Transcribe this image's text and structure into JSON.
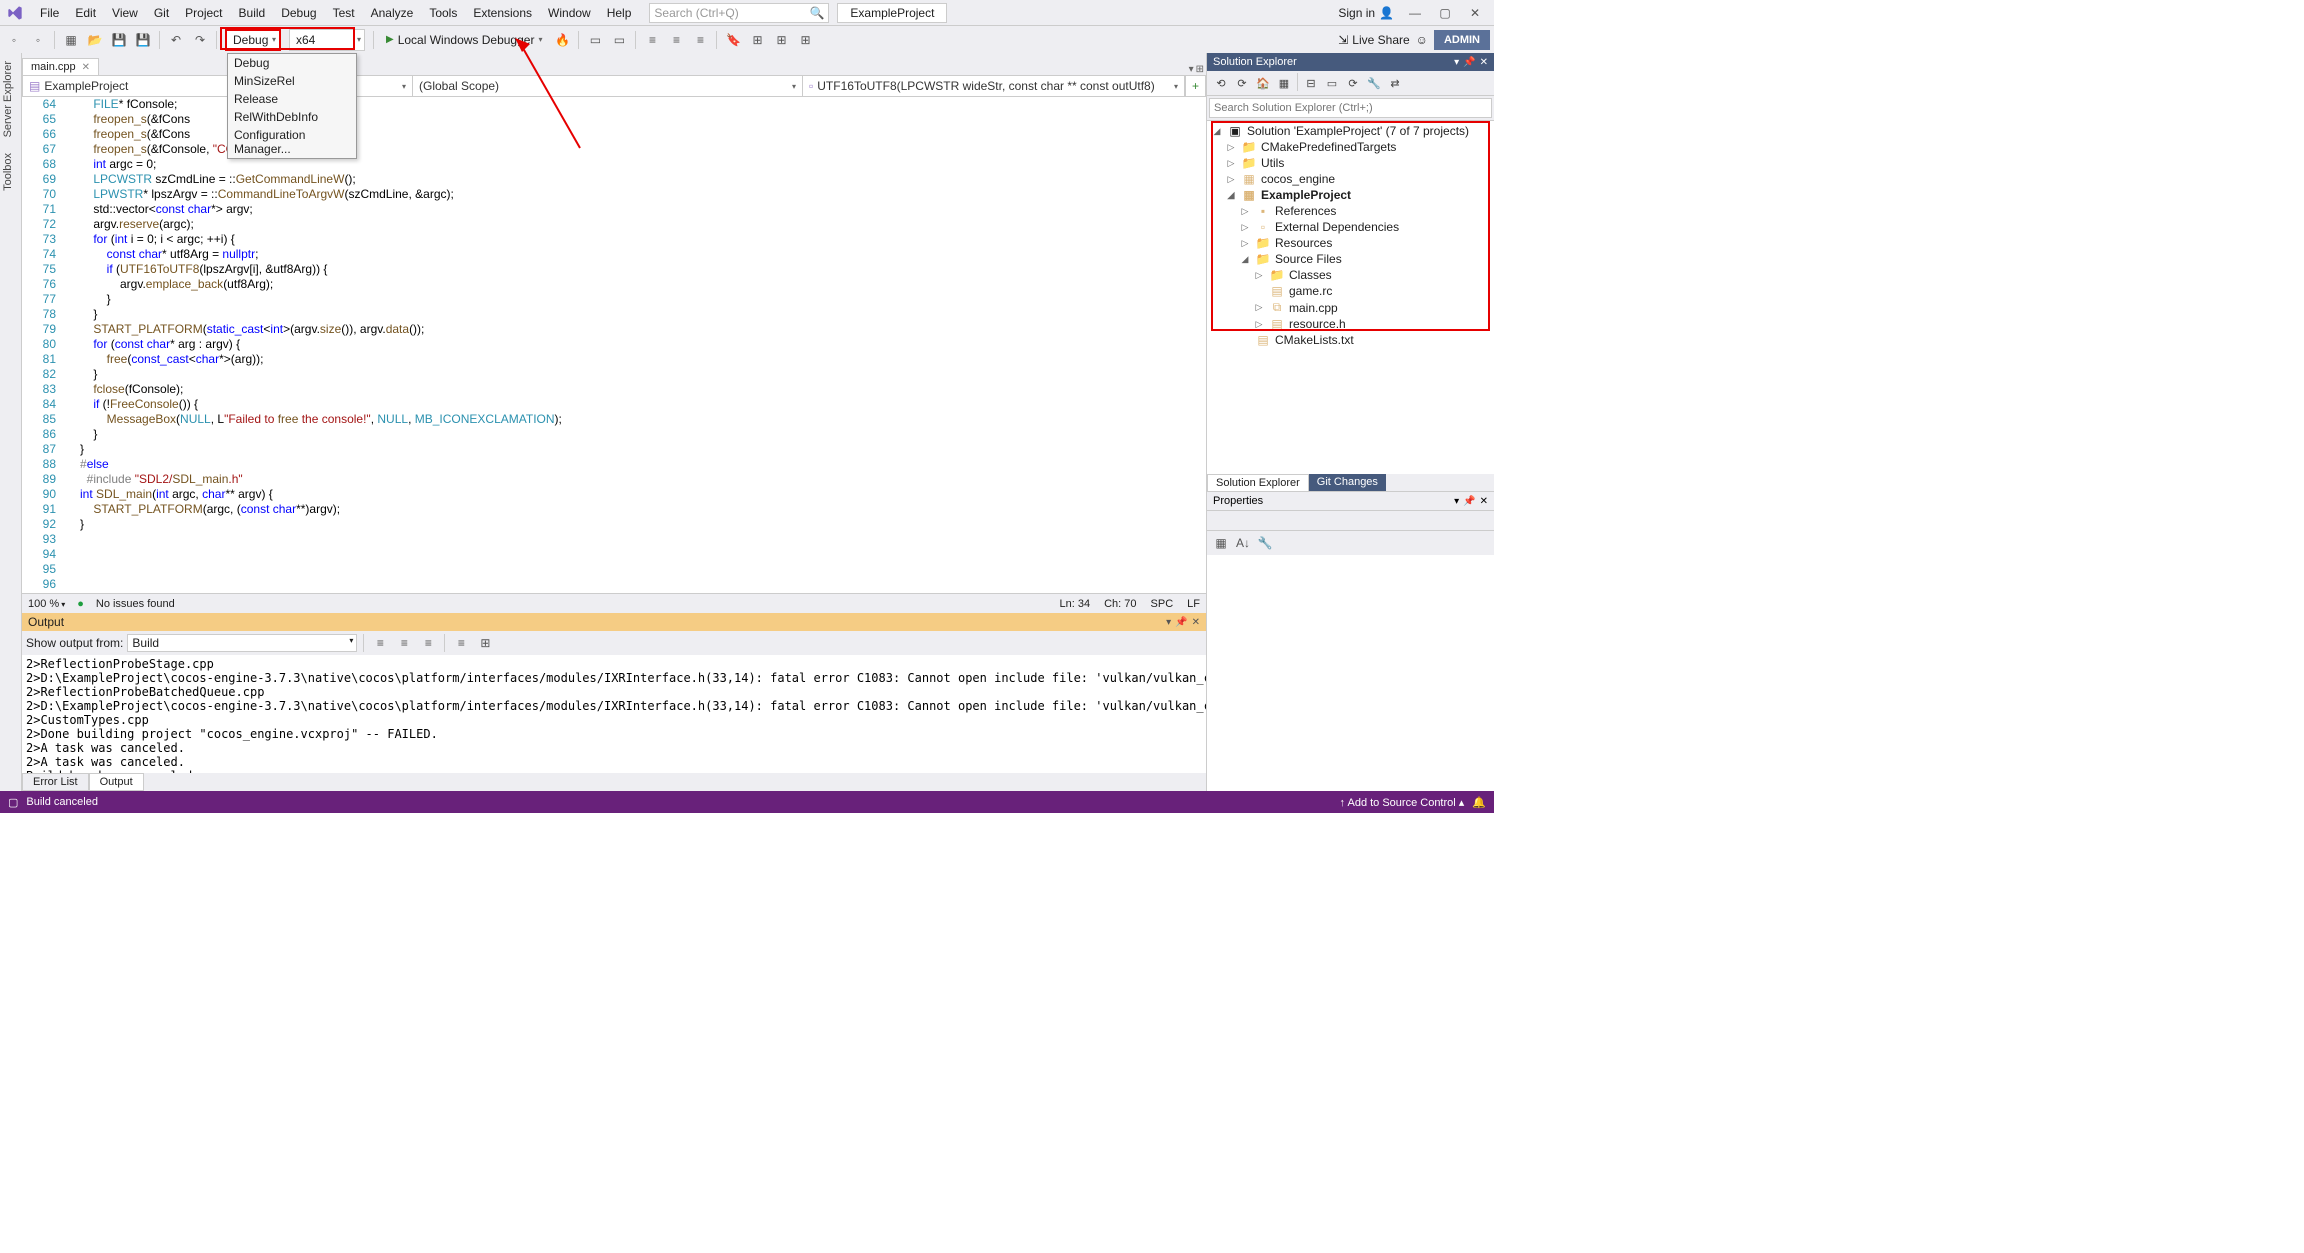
{
  "menu": {
    "items": [
      "File",
      "Edit",
      "View",
      "Git",
      "Project",
      "Build",
      "Debug",
      "Test",
      "Analyze",
      "Tools",
      "Extensions",
      "Window",
      "Help"
    ]
  },
  "search": {
    "placeholder": "Search (Ctrl+Q)"
  },
  "project_box": "ExampleProject",
  "signin": "Sign in",
  "toolbar": {
    "config": "Debug",
    "platform": "x64",
    "debugger": "Local Windows Debugger",
    "liveshare": "Live Share",
    "admin": "ADMIN",
    "dropdown": [
      "Debug",
      "MinSizeRel",
      "Release",
      "RelWithDebInfo",
      "Configuration Manager..."
    ]
  },
  "left_dock": [
    "Server Explorer",
    "Toolbox"
  ],
  "tab": {
    "name": "main.cpp"
  },
  "breadcrumb": {
    "a": "ExampleProject",
    "b": "(Global Scope)",
    "c": "UTF16ToUTF8(LPCWSTR wideStr, const char ** const outUtf8)"
  },
  "code_lines": [
    "    FILE* fConsole;",
    "    freopen_s(&fCons                     out);",
    "    freopen_s(&fCons                     err);",
    "    freopen_s(&fConsole, \"CONIN$\", \"r\", stdin);",
    "",
    "    int argc = 0;",
    "",
    "    LPCWSTR szCmdLine = ::GetCommandLineW();",
    "    LPWSTR* lpszArgv = ::CommandLineToArgvW(szCmdLine, &argc);",
    "",
    "    std::vector<const char*> argv;",
    "    argv.reserve(argc);",
    "    for (int i = 0; i < argc; ++i) {",
    "        const char* utf8Arg = nullptr;",
    "        if (UTF16ToUTF8(lpszArgv[i], &utf8Arg)) {",
    "            argv.emplace_back(utf8Arg);",
    "        }",
    "    }",
    "",
    "    START_PLATFORM(static_cast<int>(argv.size()), argv.data());",
    "",
    "    for (const char* arg : argv) {",
    "        free(const_cast<char*>(arg));",
    "    }",
    "",
    "    fclose(fConsole);",
    "    if (!FreeConsole()) {",
    "        MessageBox(NULL, L\"Failed to free the console!\", NULL, MB_ICONEXCLAMATION);",
    "    }",
    "}",
    "#else",
    "  #include \"SDL2/SDL_main.h\"",
    "",
    "int SDL_main(int argc, char** argv) {",
    "    START_PLATFORM(argc, (const char**)argv);",
    "}"
  ],
  "line_start": 64,
  "ed_status": {
    "zoom": "100 %",
    "issues": "No issues found",
    "ln": "Ln: 34",
    "ch": "Ch: 70",
    "spc": "SPC",
    "lf": "LF"
  },
  "output": {
    "title": "Output",
    "from_label": "Show output from:",
    "from": "Build",
    "text": "2>ReflectionProbeStage.cpp\n2>D:\\ExampleProject\\cocos-engine-3.7.3\\native\\cocos\\platform/interfaces/modules/IXRInterface.h(33,14): fatal error C1083: Cannot open include file: 'vulkan/vulkan_core.h': No such file or directory (compiling source file D\n2>ReflectionProbeBatchedQueue.cpp\n2>D:\\ExampleProject\\cocos-engine-3.7.3\\native\\cocos\\platform/interfaces/modules/IXRInterface.h(33,14): fatal error C1083: Cannot open include file: 'vulkan/vulkan_core.h': No such file or directory (compiling source file D\n2>CustomTypes.cpp\n2>Done building project \"cocos_engine.vcxproj\" -- FAILED.\n2>A task was canceled.\n2>A task was canceled.\nBuild has been canceled.",
    "tabs": [
      "Error List",
      "Output"
    ]
  },
  "status": {
    "msg": "Build canceled",
    "src": "Add to Source Control"
  },
  "explorer": {
    "title": "Solution Explorer",
    "search_ph": "Search Solution Explorer (Ctrl+;)",
    "sol": "Solution 'ExampleProject' (7 of 7 projects)",
    "nodes": [
      {
        "d": 1,
        "e": "▷",
        "i": "📁",
        "t": "CMakePredefinedTargets"
      },
      {
        "d": 1,
        "e": "▷",
        "i": "📁",
        "t": "Utils"
      },
      {
        "d": 1,
        "e": "▷",
        "i": "▦",
        "t": "cocos_engine"
      },
      {
        "d": 1,
        "e": "◢",
        "i": "▦",
        "t": "ExampleProject",
        "b": true
      },
      {
        "d": 2,
        "e": "▷",
        "i": "▪",
        "t": "References"
      },
      {
        "d": 2,
        "e": "▷",
        "i": "▫",
        "t": "External Dependencies"
      },
      {
        "d": 2,
        "e": "▷",
        "i": "📁",
        "t": "Resources"
      },
      {
        "d": 2,
        "e": "◢",
        "i": "📁",
        "t": "Source Files"
      },
      {
        "d": 3,
        "e": "▷",
        "i": "📁",
        "t": "Classes"
      },
      {
        "d": 3,
        "e": " ",
        "i": "▤",
        "t": "game.rc"
      },
      {
        "d": 3,
        "e": "▷",
        "i": "⧉",
        "t": "main.cpp"
      },
      {
        "d": 3,
        "e": "▷",
        "i": "▤",
        "t": "resource.h"
      },
      {
        "d": 2,
        "e": " ",
        "i": "▤",
        "t": "CMakeLists.txt"
      }
    ],
    "tabs": [
      "Solution Explorer",
      "Git Changes"
    ]
  },
  "props": {
    "title": "Properties"
  }
}
